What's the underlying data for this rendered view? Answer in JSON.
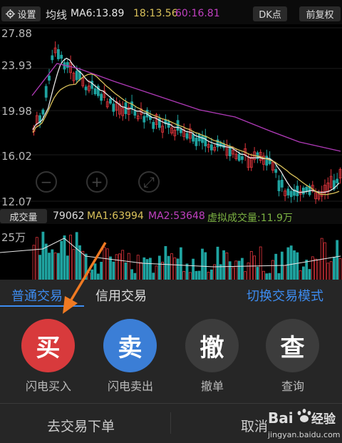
{
  "topbar": {
    "settings_label": "设置",
    "ma_label": "均线",
    "ma6": "MA6:13.89",
    "ma_b": "18:13.56",
    "ma_c": "60:16.81",
    "dk_label": "DK点",
    "fuquan_label": "前复权"
  },
  "price_axis": [
    "27.88",
    "23.93",
    "19.98",
    "16.02",
    "12.07"
  ],
  "volume": {
    "tab_label": "成交量",
    "value": "79062",
    "ma1": "MA1:63994",
    "ma2": "MA2:53648",
    "virtual": "虚拟成交量:11.9万",
    "axis_top": "25万"
  },
  "trade": {
    "tab_normal": "普通交易",
    "tab_credit": "信用交易",
    "switch_mode": "切换交易模式",
    "buy_icon": "买",
    "buy_label": "闪电买入",
    "sell_icon": "卖",
    "sell_label": "闪电卖出",
    "cancel_icon": "撤",
    "cancel_label": "撤单",
    "query_icon": "查",
    "query_label": "查询",
    "goto_order": "去交易下单",
    "cancel_text": "取消"
  },
  "watermark": {
    "brand": "Baidu经验",
    "url": "jingyan.baidu.com"
  },
  "colors": {
    "buy": "#d83a3c",
    "sell": "#3b7ed6",
    "accent": "#3d8cf0",
    "up": "#e0353c",
    "down": "#1fa3a0"
  },
  "chart_data": {
    "type": "candlestick",
    "yticks": [
      27.88,
      23.93,
      19.98,
      16.02,
      12.07
    ],
    "ma6_last": 13.89,
    "ma18_last": 13.56,
    "ma60_last": 16.81
  }
}
